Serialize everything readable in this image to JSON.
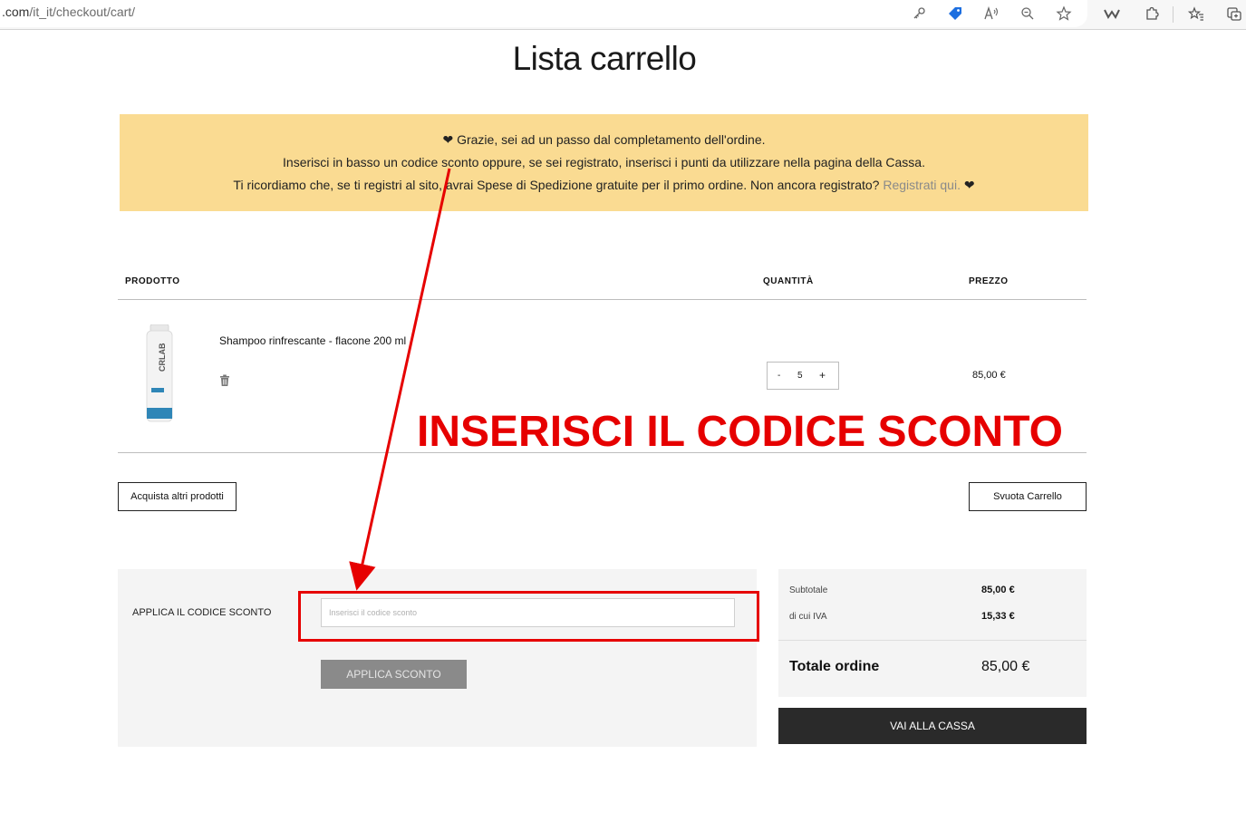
{
  "browser": {
    "url_host": ".com",
    "url_path": "/it_it/checkout/cart/"
  },
  "page": {
    "title": "Lista carrello"
  },
  "notice": {
    "line1": "❤ Grazie, sei ad un passo dal completamento dell'ordine.",
    "line2": "Inserisci in basso un codice sconto oppure, se sei registrato, inserisci i punti da utilizzare nella pagina della Cassa.",
    "line3": "Ti ricordiamo che, se ti registri al sito, avrai Spese di Spedizione gratuite per il primo ordine. Non ancora registrato?",
    "link": "Registrati qui.",
    "heart": "❤"
  },
  "table": {
    "headers": {
      "product": "PRODOTTO",
      "quantity": "QUANTITÀ",
      "price": "PREZZO"
    },
    "items": [
      {
        "name": "Shampoo rinfrescante - flacone 200 ml",
        "quantity": "5",
        "price": "85,00 €"
      }
    ]
  },
  "qty_controls": {
    "minus": "-",
    "plus": "+"
  },
  "annotation": {
    "text": "INSERISCI IL CODICE SCONTO",
    "color": "#e60000"
  },
  "actions": {
    "continue_shopping": "Acquista altri prodotti",
    "empty_cart": "Svuota Carrello"
  },
  "coupon": {
    "label": "APPLICA IL CODICE SCONTO",
    "placeholder": "Inserisci il codice sconto",
    "button": "APPLICA SCONTO"
  },
  "summary": {
    "subtotal_label": "Subtotale",
    "subtotal_value": "85,00 €",
    "tax_label": "di cui IVA",
    "tax_value": "15,33 €",
    "total_label": "Totale ordine",
    "total_value": "85,00 €",
    "checkout_button": "VAI ALLA CASSA"
  },
  "colors": {
    "notice_bg": "#fadb92",
    "checkout_bg": "#2a2a2a",
    "annotation_red": "#e60000",
    "panel_bg": "#f4f4f4"
  },
  "icons": [
    "key-icon",
    "tag-icon",
    "read-aloud-icon",
    "zoom-out-icon",
    "favorite-star-icon",
    "extension-icon",
    "favorites-icon",
    "collections-icon",
    "trash-icon"
  ]
}
